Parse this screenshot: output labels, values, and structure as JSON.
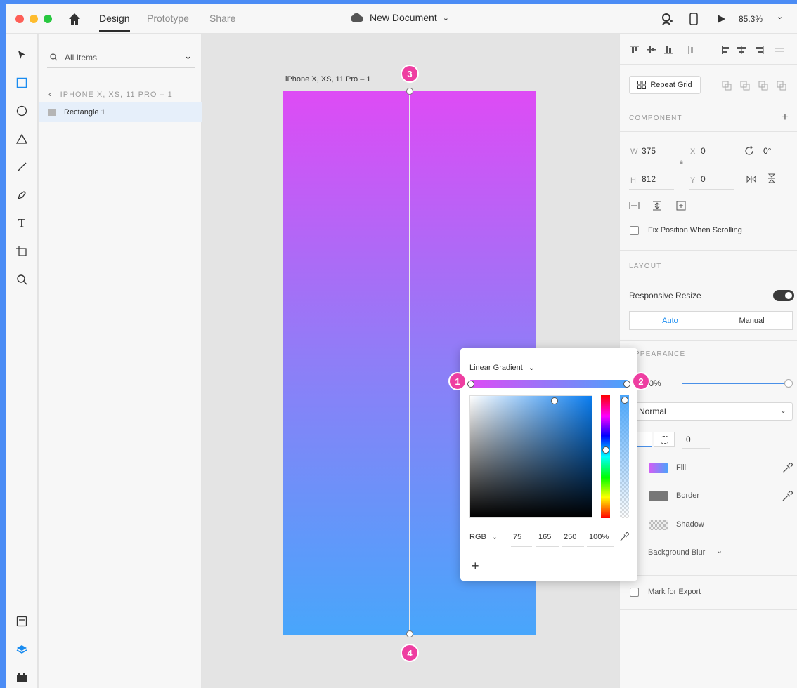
{
  "titlebar": {
    "tabs": [
      "Design",
      "Prototype",
      "Share"
    ],
    "doc_title": "New Document",
    "zoom": "85.3%"
  },
  "layers": {
    "search_label": "All Items",
    "breadcrumb": "IPHONE X, XS, 11 PRO – 1",
    "item": "Rectangle 1"
  },
  "canvas": {
    "artboard_title": "iPhone X, XS, 11 Pro – 1",
    "badges": [
      "1",
      "2",
      "3",
      "4"
    ],
    "gradient_start": "#de4bf5",
    "gradient_end": "#48a6fb"
  },
  "props": {
    "repeat_grid": "Repeat Grid",
    "component_hdr": "COMPONENT",
    "w_label": "W",
    "w_val": "375",
    "h_label": "H",
    "h_val": "812",
    "x_label": "X",
    "x_val": "0",
    "y_label": "Y",
    "y_val": "0",
    "rotation": "0°",
    "fix_position": "Fix Position When Scrolling",
    "layout_hdr": "LAYOUT",
    "responsive": "Responsive Resize",
    "auto": "Auto",
    "manual": "Manual",
    "appearance_hdr": "APPEARANCE",
    "opacity": "100%",
    "blend": "Normal",
    "radius": "0",
    "fill": "Fill",
    "border": "Border",
    "shadow": "Shadow",
    "bg_blur": "Background Blur",
    "export": "Mark for Export"
  },
  "picker": {
    "mode": "Linear Gradient",
    "color_mode": "RGB",
    "r": "75",
    "g": "165",
    "b": "250",
    "alpha": "100%"
  },
  "colors": {
    "accent": "#1a8cf0",
    "badge": "#ee3ea1"
  }
}
